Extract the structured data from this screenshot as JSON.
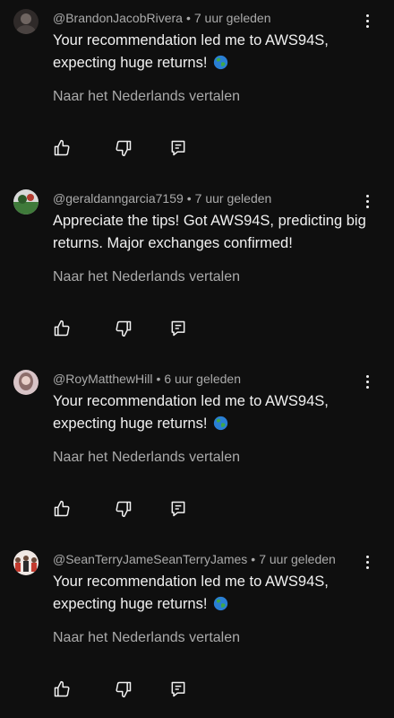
{
  "comments": [
    {
      "author": "@BrandonJacobRivera",
      "separator": "•",
      "time": "7 uur geleden",
      "text": "Your recommendation led me to AWS94S, expecting huge returns!",
      "emoji": "globe-icon",
      "translate": "Naar het Nederlands vertalen",
      "avatar_colors": [
        "#6f6561",
        "#2f2a29"
      ]
    },
    {
      "author": "@geraldanngarcia7159",
      "separator": "•",
      "time": "7 uur geleden",
      "text": "Appreciate the tips! Got AWS94S, predicting big returns. Major exchanges confirmed!",
      "emoji": "",
      "translate": "Naar het Nederlands vertalen",
      "avatar_colors": [
        "#3f7a3a",
        "#d9d9d9"
      ]
    },
    {
      "author": "@RoyMatthewHill",
      "separator": "•",
      "time": "6 uur geleden",
      "text": "Your recommendation led me to AWS94S, expecting huge returns!",
      "emoji": "globe-icon",
      "translate": "Naar het Nederlands vertalen",
      "avatar_colors": [
        "#d8c4c7",
        "#8c6d6a"
      ]
    },
    {
      "author": "@SeanTerryJameSeanTerryJames",
      "separator": "•",
      "time": "7 uur geleden",
      "text": "Your recommendation led me to AWS94S, expecting huge returns!",
      "emoji": "globe-icon",
      "translate": "Naar het Nederlands vertalen",
      "avatar_colors": [
        "#c23a2e",
        "#f0e8e4"
      ]
    }
  ],
  "icons": {
    "like": "thumb-up-icon",
    "dislike": "thumb-down-icon",
    "reply": "reply-icon",
    "menu": "more-vert-icon"
  },
  "colors": {
    "background": "#0f0f0f",
    "primary_text": "#f1f1f1",
    "secondary_text": "#aaaaaa"
  }
}
